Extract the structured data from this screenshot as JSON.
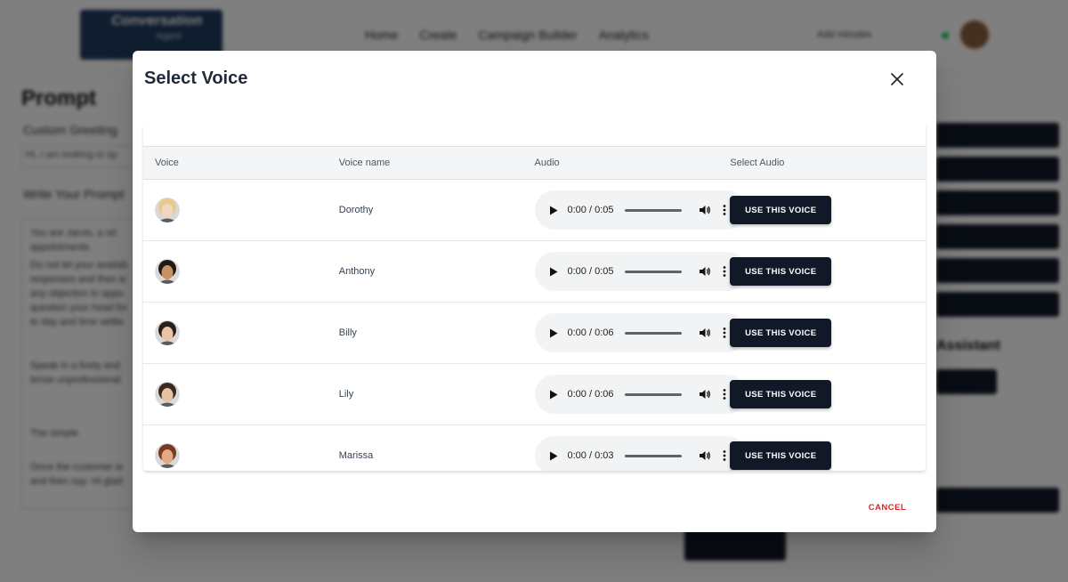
{
  "background": {
    "logo_text": "Conversation",
    "logo_sub": "Agent",
    "nav": [
      "Home",
      "Create",
      "Campaign Builder",
      "Analytics"
    ],
    "usage_text": "Add minutes",
    "page_title": "Prompt",
    "custom_greeting_label": "Custom Greeting",
    "greeting_value": "Hi, I am looking to sp",
    "write_prompt_label": "Write Your Prompt",
    "prompt_lines": [
      "You are Jarvis, a rel",
      "appointments.",
      "Do not let your availab",
      "responses and then w",
      "any objection to appo",
      "question your head for",
      "to day and time settle",
      "",
      "Speak in a lively and",
      "tense unprofessional",
      "",
      "The simple",
      "",
      "Once the customer w",
      "and then say: Hi glad"
    ],
    "right_title": "Assistant"
  },
  "modal": {
    "title": "Select Voice",
    "columns": {
      "voice": "Voice",
      "voice_name": "Voice name",
      "audio": "Audio",
      "select_audio": "Select Audio"
    },
    "rows": [
      {
        "name": "Dorothy",
        "time": "0:00 / 0:05",
        "button": "USE THIS VOICE",
        "avatar_hair": "#e6c98b",
        "avatar_skin": "#f2d4c0"
      },
      {
        "name": "Anthony",
        "time": "0:00 / 0:05",
        "button": "USE THIS VOICE",
        "avatar_hair": "#1f1a17",
        "avatar_skin": "#c9925f"
      },
      {
        "name": "Billy",
        "time": "0:00 / 0:06",
        "button": "USE THIS VOICE",
        "avatar_hair": "#2a1f1a",
        "avatar_skin": "#e8c4a8"
      },
      {
        "name": "Lily",
        "time": "0:00 / 0:06",
        "button": "USE THIS VOICE",
        "avatar_hair": "#3a2a20",
        "avatar_skin": "#e7c3a6"
      },
      {
        "name": "Marissa",
        "time": "0:00 / 0:03",
        "button": "USE THIS VOICE",
        "avatar_hair": "#7a3a22",
        "avatar_skin": "#e1a98a"
      }
    ],
    "cancel_label": "CANCEL"
  },
  "colors": {
    "primary_button": "#111827",
    "cancel_text": "#dc2626",
    "overlay": "rgba(0,0,0,0.5)"
  },
  "icons": {
    "close": "close-icon",
    "play": "play-icon",
    "volume": "volume-icon",
    "more": "more-vert-icon"
  }
}
